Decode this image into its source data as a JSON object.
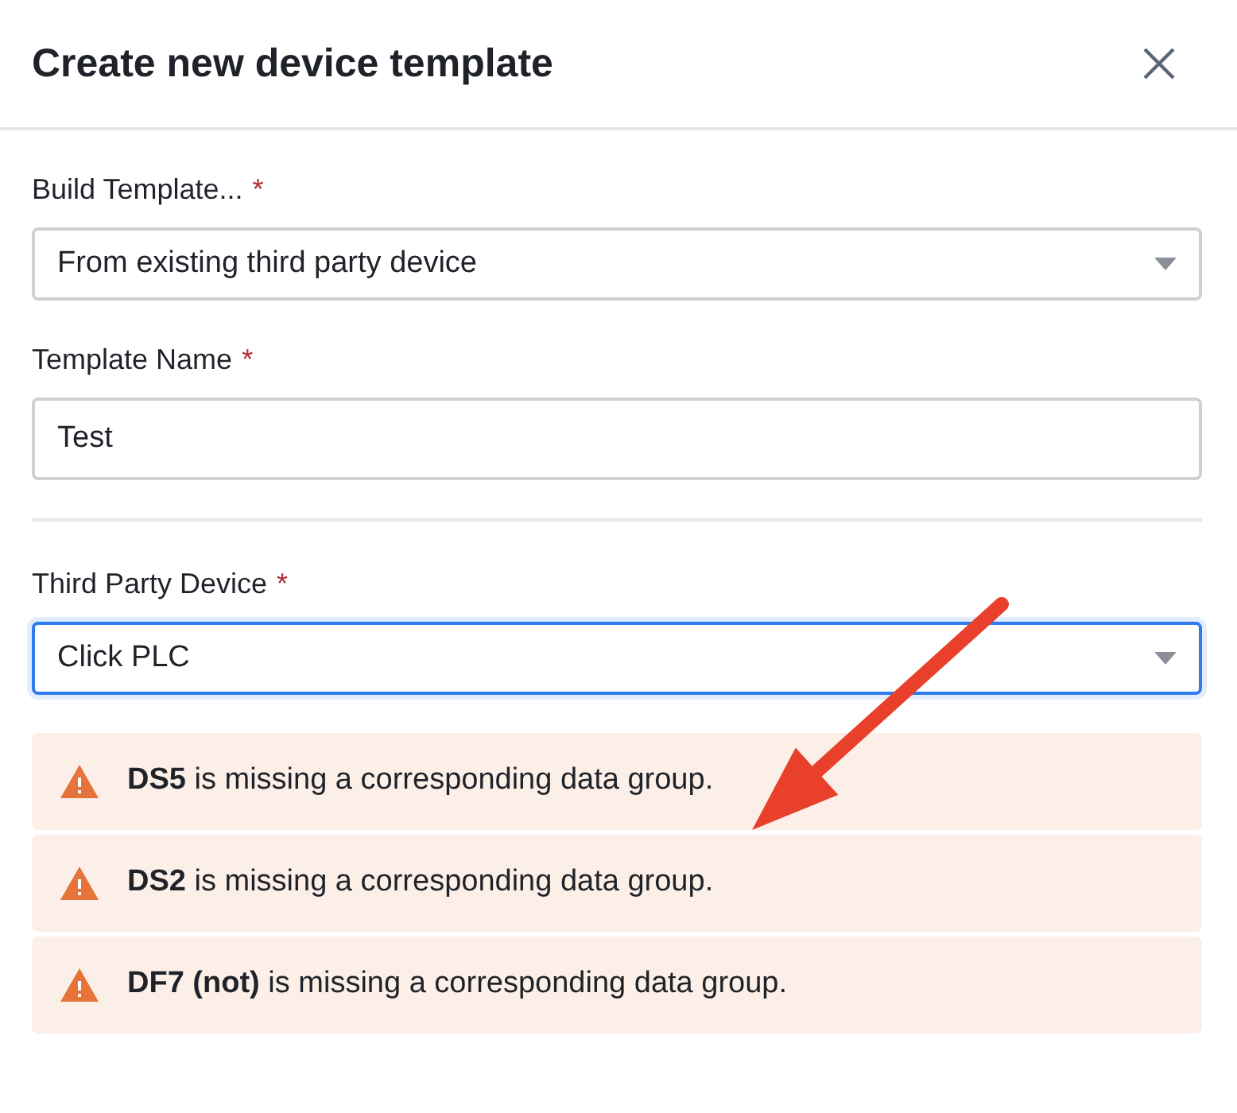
{
  "dialog": {
    "title": "Create new device template"
  },
  "sections": [
    {
      "fields": [
        {
          "label": "Build Template...",
          "required_mark": "*",
          "kind": "select",
          "value": "From existing third party device",
          "focused": false
        },
        {
          "label": "Template Name",
          "required_mark": "*",
          "kind": "text",
          "value": "Test",
          "focused": false
        }
      ]
    },
    {
      "fields": [
        {
          "label": "Third Party Device",
          "required_mark": "*",
          "kind": "select",
          "value": "Click PLC",
          "focused": true
        }
      ]
    }
  ],
  "warnings": [
    {
      "text": "**DS5** is missing a corresponding data group."
    },
    {
      "text": "**DS2** is missing a corresponding data group."
    },
    {
      "text": "**DF7 (not)** is missing a corresponding data group."
    }
  ]
}
